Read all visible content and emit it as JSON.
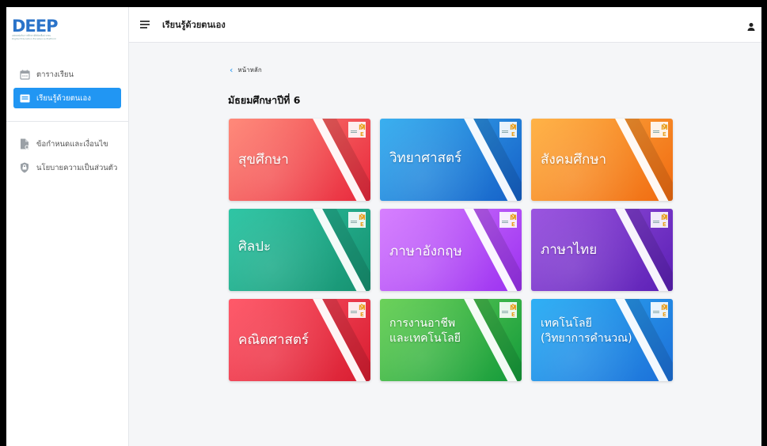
{
  "sidebar": {
    "logo": "DEEP",
    "logo_sub": "แพลตฟอร์มการศึกษาดิจิทัลเพื่อปวงชน",
    "logo_sub2": "Digital Education Excellence Platform",
    "items": [
      {
        "label": "ตารางเรียน",
        "icon": "calendar-icon",
        "active": false
      },
      {
        "label": "เรียนรู้ด้วยตนเอง",
        "icon": "book-icon",
        "active": true
      },
      {
        "label": "ข้อกำหนดและเงื่อนไข",
        "icon": "document-icon",
        "active": false
      },
      {
        "label": "นโยบายความเป็นส่วนตัว",
        "icon": "shield-icon",
        "active": false
      }
    ]
  },
  "topbar": {
    "title": "เรียนรู้ด้วยตนเอง",
    "menu_icon": "menu-icon",
    "user_icon": "user-icon"
  },
  "main": {
    "back_label": "หน้าหลัก",
    "heading": "มัธยมศึกษาปีที่ 6",
    "subjects": [
      {
        "label": "สุขศึกษา",
        "color_start": "#ff8a7a",
        "color_end": "#e8283c"
      },
      {
        "label": "วิทยาศาสตร์",
        "color_start": "#3ab0f0",
        "color_end": "#1560c8"
      },
      {
        "label": "สังคมศึกษา",
        "color_start": "#ffb347",
        "color_end": "#f06a10"
      },
      {
        "label": "ศิลปะ",
        "color_start": "#2fc6a5",
        "color_end": "#169170"
      },
      {
        "label": "ภาษาอังกฤษ",
        "color_start": "#d780ff",
        "color_end": "#9b30f0"
      },
      {
        "label": "ภาษาไทย",
        "color_start": "#9b55e0",
        "color_end": "#5b1fb5"
      },
      {
        "label": "คณิตศาสตร์",
        "color_start": "#ff5a6a",
        "color_end": "#d81c30"
      },
      {
        "label": "การงานอาชีพ\nและเทคโนโลยี",
        "color_start": "#6cd25a",
        "color_end": "#139a3a"
      },
      {
        "label": "เทคโนโลยี\n(วิทยาการคำนวณ)",
        "color_start": "#2fb0f5",
        "color_end": "#1c6fd8"
      }
    ]
  }
}
